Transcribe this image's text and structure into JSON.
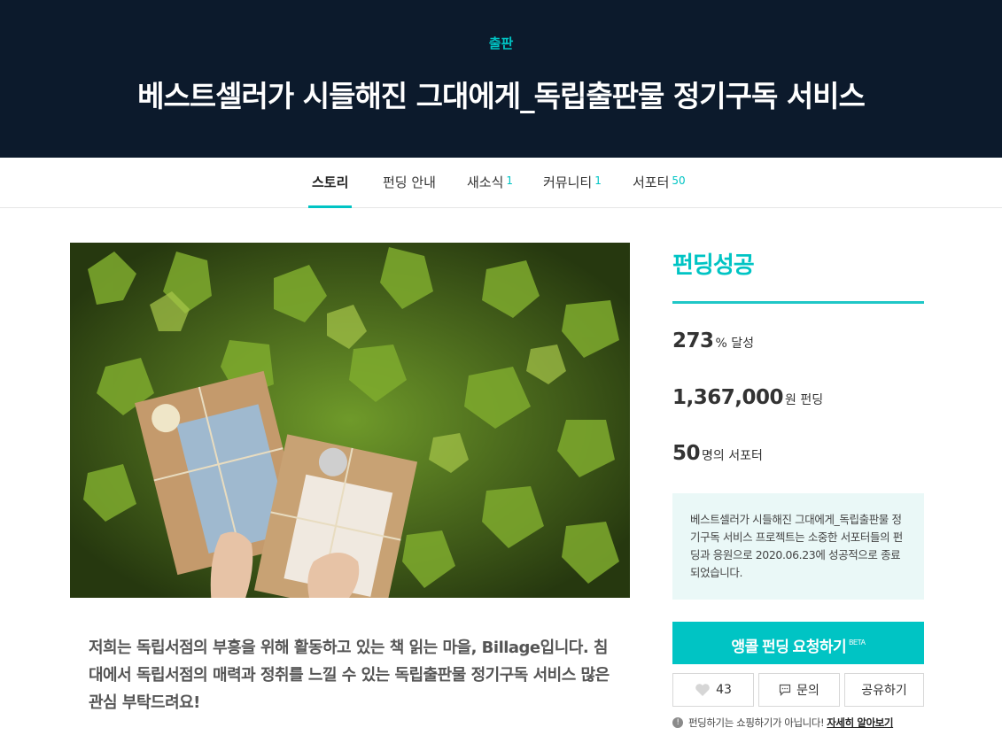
{
  "header": {
    "category": "출판",
    "title": "베스트셀러가 시들해진 그대에게_독립출판물 정기구독 서비스"
  },
  "tabs": [
    {
      "label": "스토리",
      "count": ""
    },
    {
      "label": "펀딩 안내",
      "count": ""
    },
    {
      "label": "새소식",
      "count": "1"
    },
    {
      "label": "커뮤니티",
      "count": "1"
    },
    {
      "label": "서포터",
      "count": "50"
    }
  ],
  "intro": "저희는 독립서점의 부흥을 위해 활동하고 있는 책 읽는 마을, Billage입니다. 침대에서 독립서점의 매력과 정취를 느낄 수 있는 독립출판물 정기구독 서비스 많은 관심 부탁드려요!",
  "sidebar": {
    "status": "펀딩성공",
    "stats": {
      "percent": "273",
      "percent_unit": "% 달성",
      "amount": "1,367,000",
      "amount_unit": "원 펀딩",
      "supporters": "50",
      "supporters_unit": "명의 서포터"
    },
    "notice": "베스트셀러가 시들해진 그대에게_독립출판물 정기구독 서비스 프로젝트는 소중한 서포터들의 펀딩과 응원으로 2020.06.23에 성공적으로 종료되었습니다.",
    "encore_button": "앵콜 펀딩 요청하기",
    "encore_badge": "BETA",
    "like_count": "43",
    "inquiry_button": "문의",
    "share_button": "공유하기",
    "footnote": "펀딩하기는 쇼핑하기가 아닙니다!",
    "footnote_link": "자세히 알아보기"
  },
  "icons": {
    "like": "heart-icon",
    "inquiry": "speech-bubble-icon",
    "info": "info-icon"
  },
  "colors": {
    "accent": "#00c4c4",
    "header_bg": "#0c1a2c",
    "notice_bg": "#eaf8f7"
  }
}
